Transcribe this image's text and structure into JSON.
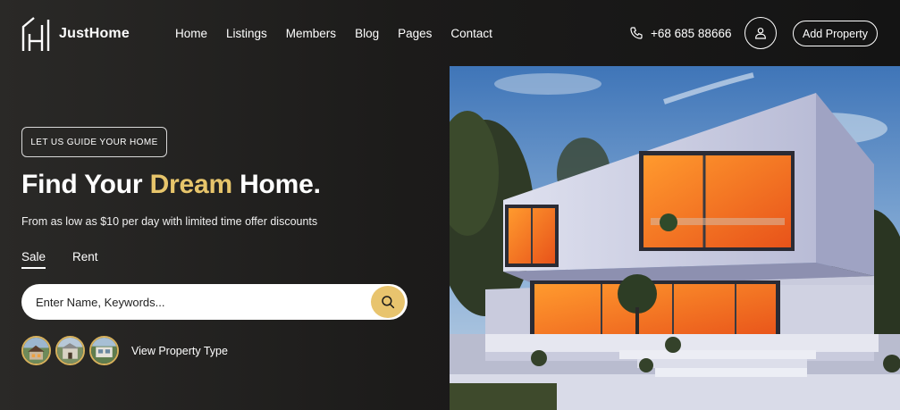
{
  "brand": {
    "name": "JustHome",
    "logo_icon": "building-logo-icon"
  },
  "nav": {
    "items": [
      {
        "label": "Home"
      },
      {
        "label": "Listings"
      },
      {
        "label": "Members"
      },
      {
        "label": "Blog"
      },
      {
        "label": "Pages"
      },
      {
        "label": "Contact"
      }
    ]
  },
  "header": {
    "phone": "+68 685 88666",
    "phone_icon": "phone-icon",
    "user_icon": "user-icon",
    "add_property_label": "Add Property"
  },
  "hero": {
    "tag_label": "LET US GUIDE YOUR HOME",
    "title_before": "Find Your ",
    "title_accent": "Dream",
    "title_after": " Home.",
    "subtitle": "From as low as $10 per day with limited time offer discounts",
    "tabs": [
      {
        "label": "Sale",
        "active": true
      },
      {
        "label": "Rent",
        "active": false
      }
    ],
    "search": {
      "placeholder": "Enter Name, Keywords...",
      "value": "",
      "icon": "search-icon"
    },
    "property_type_label": "View Property Type"
  },
  "colors": {
    "accent": "#e7c56b",
    "background": "#1b1a19",
    "text": "#ffffff"
  }
}
